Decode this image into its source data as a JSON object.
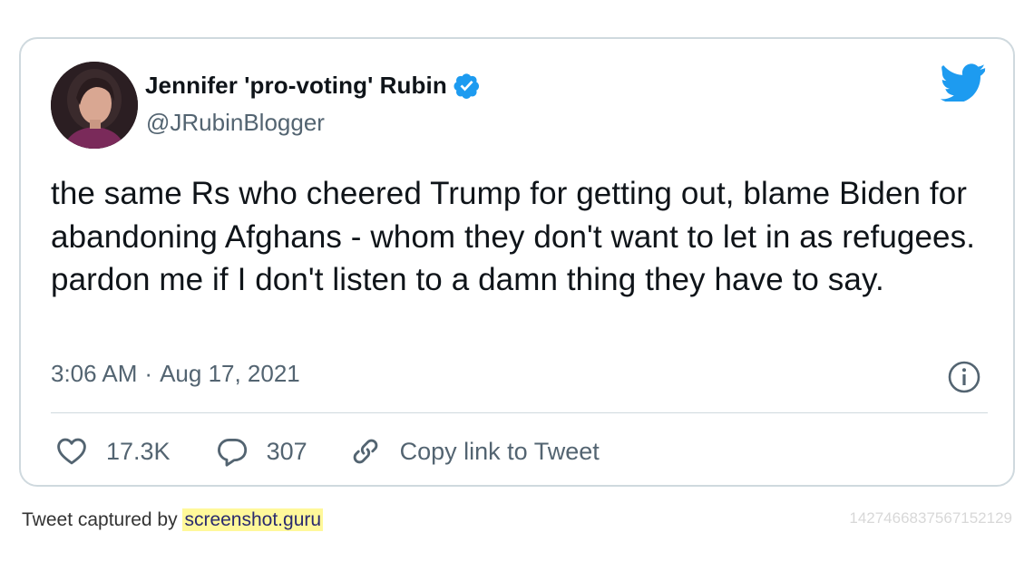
{
  "tweet": {
    "author_name": "Jennifer 'pro-voting' Rubin",
    "handle": "@JRubinBlogger",
    "verified": true,
    "text": "the same Rs who cheered Trump for getting out, blame Biden for abandoning Afghans - whom they don't want to let in as refugees. pardon me if I don't listen to a damn thing they have to say.",
    "time": "3:06 AM",
    "separator": "·",
    "date": "Aug 17, 2021",
    "likes": "17.3K",
    "replies": "307",
    "copy_link_label": "Copy link to Tweet"
  },
  "footer": {
    "captured_by": "Tweet captured by",
    "service": "screenshot.guru",
    "tweet_id": "1427466837567152129"
  },
  "colors": {
    "twitter_blue": "#1d9bf0",
    "secondary_text": "#536471",
    "border": "#cfd9de",
    "highlight": "#fff89a"
  },
  "icons": [
    "verified-badge-icon",
    "twitter-bird-icon",
    "info-icon",
    "heart-icon",
    "reply-bubble-icon",
    "link-icon"
  ]
}
